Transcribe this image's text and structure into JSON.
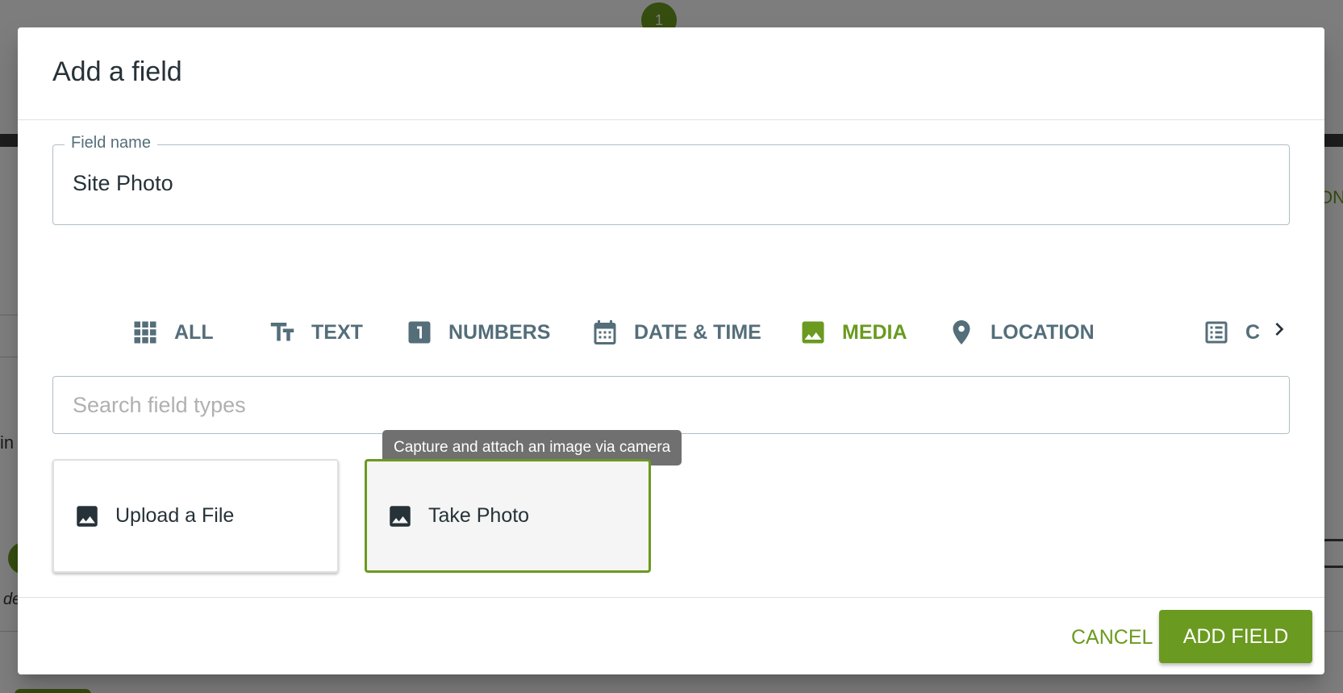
{
  "background": {
    "step_number": "1",
    "fragment_left": "in",
    "fragment_bottom": "de",
    "fragment_right": "ON"
  },
  "dialog": {
    "title": "Add a field",
    "field_name_label": "Field name",
    "field_name_value": "Site Photo",
    "tabs": [
      {
        "label": "ALL",
        "icon": "grid-icon",
        "active": false
      },
      {
        "label": "TEXT",
        "icon": "text-fields-icon",
        "active": false
      },
      {
        "label": "NUMBERS",
        "icon": "number-one-icon",
        "active": false
      },
      {
        "label": "DATE & TIME",
        "icon": "calendar-icon",
        "active": false
      },
      {
        "label": "MEDIA",
        "icon": "image-icon",
        "active": true
      },
      {
        "label": "LOCATION",
        "icon": "location-pin-icon",
        "active": false
      },
      {
        "label": "C",
        "icon": "list-icon",
        "active": false
      }
    ],
    "search_placeholder": "Search field types",
    "search_value": "",
    "tooltip": "Capture and attach an image via camera",
    "cards": [
      {
        "label": "Upload a File",
        "icon": "image-icon",
        "selected": false
      },
      {
        "label": "Take Photo",
        "icon": "image-icon",
        "selected": true
      }
    ],
    "cancel_label": "CANCEL",
    "add_label": "ADD FIELD"
  },
  "colors": {
    "accent": "#6a9a1f",
    "tab_inactive": "#546e7a",
    "text": "#263238"
  }
}
